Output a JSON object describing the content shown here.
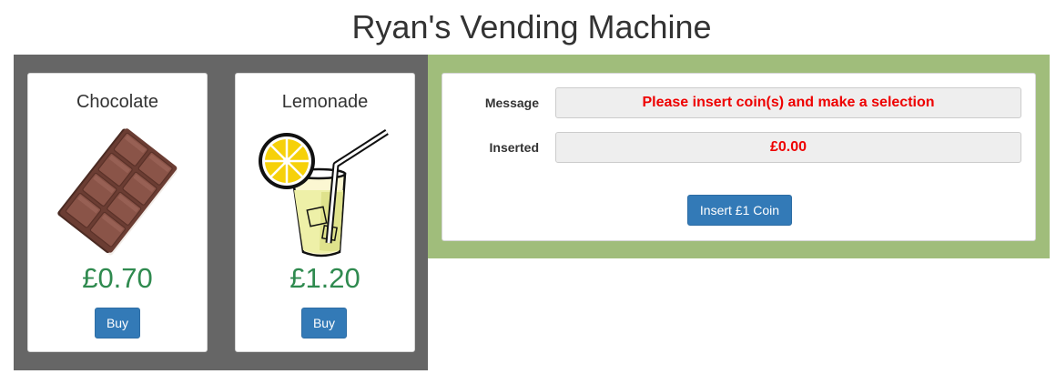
{
  "title": "Ryan's Vending Machine",
  "products": [
    {
      "name": "Chocolate",
      "price": "£0.70",
      "buy_label": "Buy",
      "icon": "chocolate-bar-icon"
    },
    {
      "name": "Lemonade",
      "price": "£1.20",
      "buy_label": "Buy",
      "icon": "lemonade-glass-icon"
    }
  ],
  "controls": {
    "message_label": "Message",
    "message_value": "Please insert coin(s) and make a selection",
    "inserted_label": "Inserted",
    "inserted_value": "£0.00",
    "insert_button_label": "Insert £1 Coin"
  },
  "colors": {
    "products_panel_bg": "#666666",
    "control_panel_bg": "#a0bd7b",
    "price": "#2f8a4f",
    "button": "#337ab7",
    "status_text": "#ee0000"
  }
}
